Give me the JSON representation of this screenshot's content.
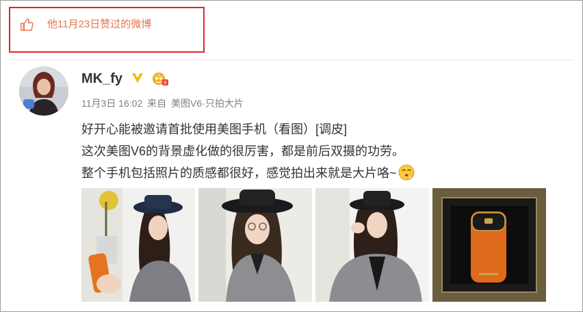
{
  "like_header": {
    "text": "他11月23日赞过的微博",
    "icon": "thumbs-up-icon"
  },
  "post": {
    "username": "MK_fy",
    "badges": [
      "verified-icon",
      "member-icon"
    ],
    "date": "11月3日 16:02",
    "source_prefix": "来自",
    "source": "美图V6·只拍大片",
    "lines": [
      "好开心能被邀请首批使用美图手机（看图）[调皮]",
      "这次美图V6的背景虚化做的很厉害，都是前后双摄的功劳。",
      "整个手机包括照片的质感都很好，感觉拍出来就是大片咯~"
    ],
    "emoji": "shh-emoji-icon",
    "photos": [
      "photo-1",
      "photo-2",
      "photo-3",
      "photo-4"
    ]
  },
  "colors": {
    "highlight_border": "#e0242a",
    "like_text": "#eb7350",
    "meta_text": "#808080",
    "body_text": "#333333",
    "verified": "#f2b705"
  }
}
